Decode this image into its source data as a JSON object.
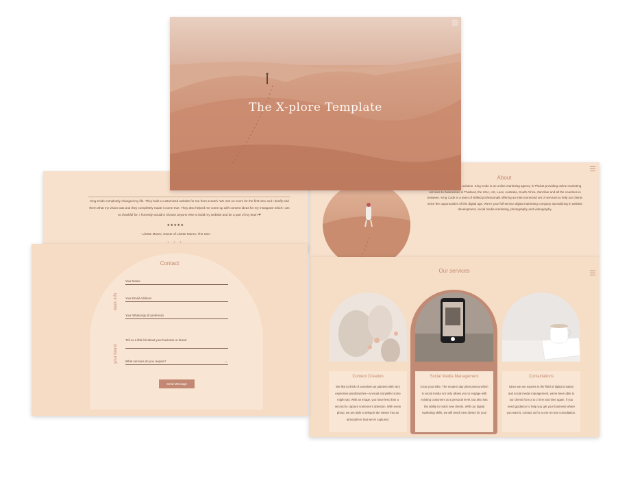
{
  "colors": {
    "sand": "#d39f86",
    "panel_bg": "#f7e1cd",
    "accent": "#c48a6e",
    "button": "#c38873",
    "text": "#6d4c3b"
  },
  "hero": {
    "title": "The X-plore Template",
    "menu_icon": "hamburger-menu-icon"
  },
  "testimonial": {
    "quote": "King Code completely changed my life. They built a customized website for me from scratch. We met on zoom for the first time and I briefly told them what my vision was and they completely made it come true. They also helped me come up with content ideas for my Instagram which I am so thankful for. I honestly wouldn't choose anyone else to build my website and be a part of my team ❤",
    "stars": "★★★★★",
    "author": "- Lisette Munro, Owner of Lisette Munro, The USA",
    "dots": "• • •"
  },
  "about": {
    "title": "About",
    "text": "...re your digital creative solution. King Code is an online marketing agency in Phuket providing online marketing services to businesses in Thailand, the USA, UK, Laos, Australia, South Africa, Zanzibar and all the countries in between. King Code is a team of skilled professionals offering an interconnected set of services to help our clients seize the opportunities of this digital age. We're your full-service digital marketing company specializing in website development, social media marketing, photography and videography."
  },
  "services": {
    "title": "Our services",
    "cards": [
      {
        "title": "Content Creation",
        "text": "We like to think of ourselves as painters with very expensive paintbrushes—a visual storyteller some might say. With an image, you have less than a second to capture someone's attention. With every photo, we are able to teleport the viewer into an atmosphere that we've captured."
      },
      {
        "title": "Social Media Management",
        "text": "Grow your tribe. The modern day phenomena which is social media not only allows you to engage with existing customers at a personal level, but also has the ability to reach new clients. With our digital marketing skills, we will reach new clients for you!"
      },
      {
        "title": "Consultations",
        "text": "Since we are experts in the field of digital creation and social media management, we've been able to our clients from a to z time and time again. If you need guidance to help you get your business where you want it, contact us for a one-on-one consultation."
      }
    ]
  },
  "contact": {
    "title": "Contact",
    "basic_info_label": "basic info",
    "your_brand_label": "your brand",
    "fields": {
      "name": "Your Name",
      "email": "Your Email Address",
      "whatsapp": "Your WhatsApp (if preferred)",
      "business": "Tell us a little bit about your business or brand",
      "services": "What services do you require?"
    },
    "send_label": "Send Message"
  }
}
